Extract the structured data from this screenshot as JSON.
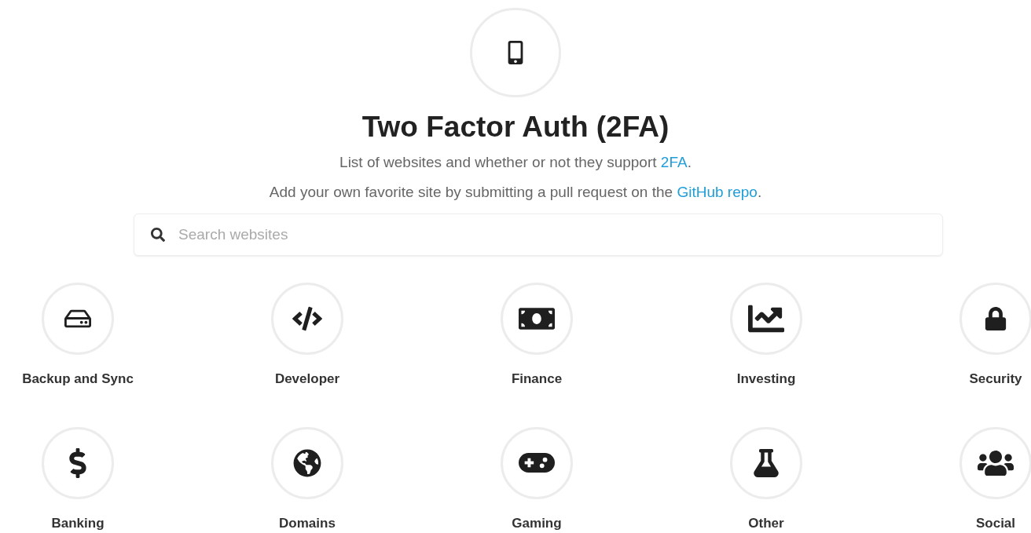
{
  "title": "Two Factor Auth (2FA)",
  "intro": [
    {
      "before": "List of websites and whether or not they support ",
      "link": "2FA",
      "after": "."
    },
    {
      "before": "Add your own favorite site by submitting a pull request on the ",
      "link": "GitHub repo",
      "after": "."
    }
  ],
  "search": {
    "placeholder": "Search websites"
  },
  "categories": [
    {
      "label": "Backup and Sync"
    },
    {
      "label": "Developer"
    },
    {
      "label": "Finance"
    },
    {
      "label": "Investing"
    },
    {
      "label": "Security"
    },
    {
      "label": "Banking"
    },
    {
      "label": "Domains"
    },
    {
      "label": "Gaming"
    },
    {
      "label": "Other"
    },
    {
      "label": "Social"
    }
  ]
}
